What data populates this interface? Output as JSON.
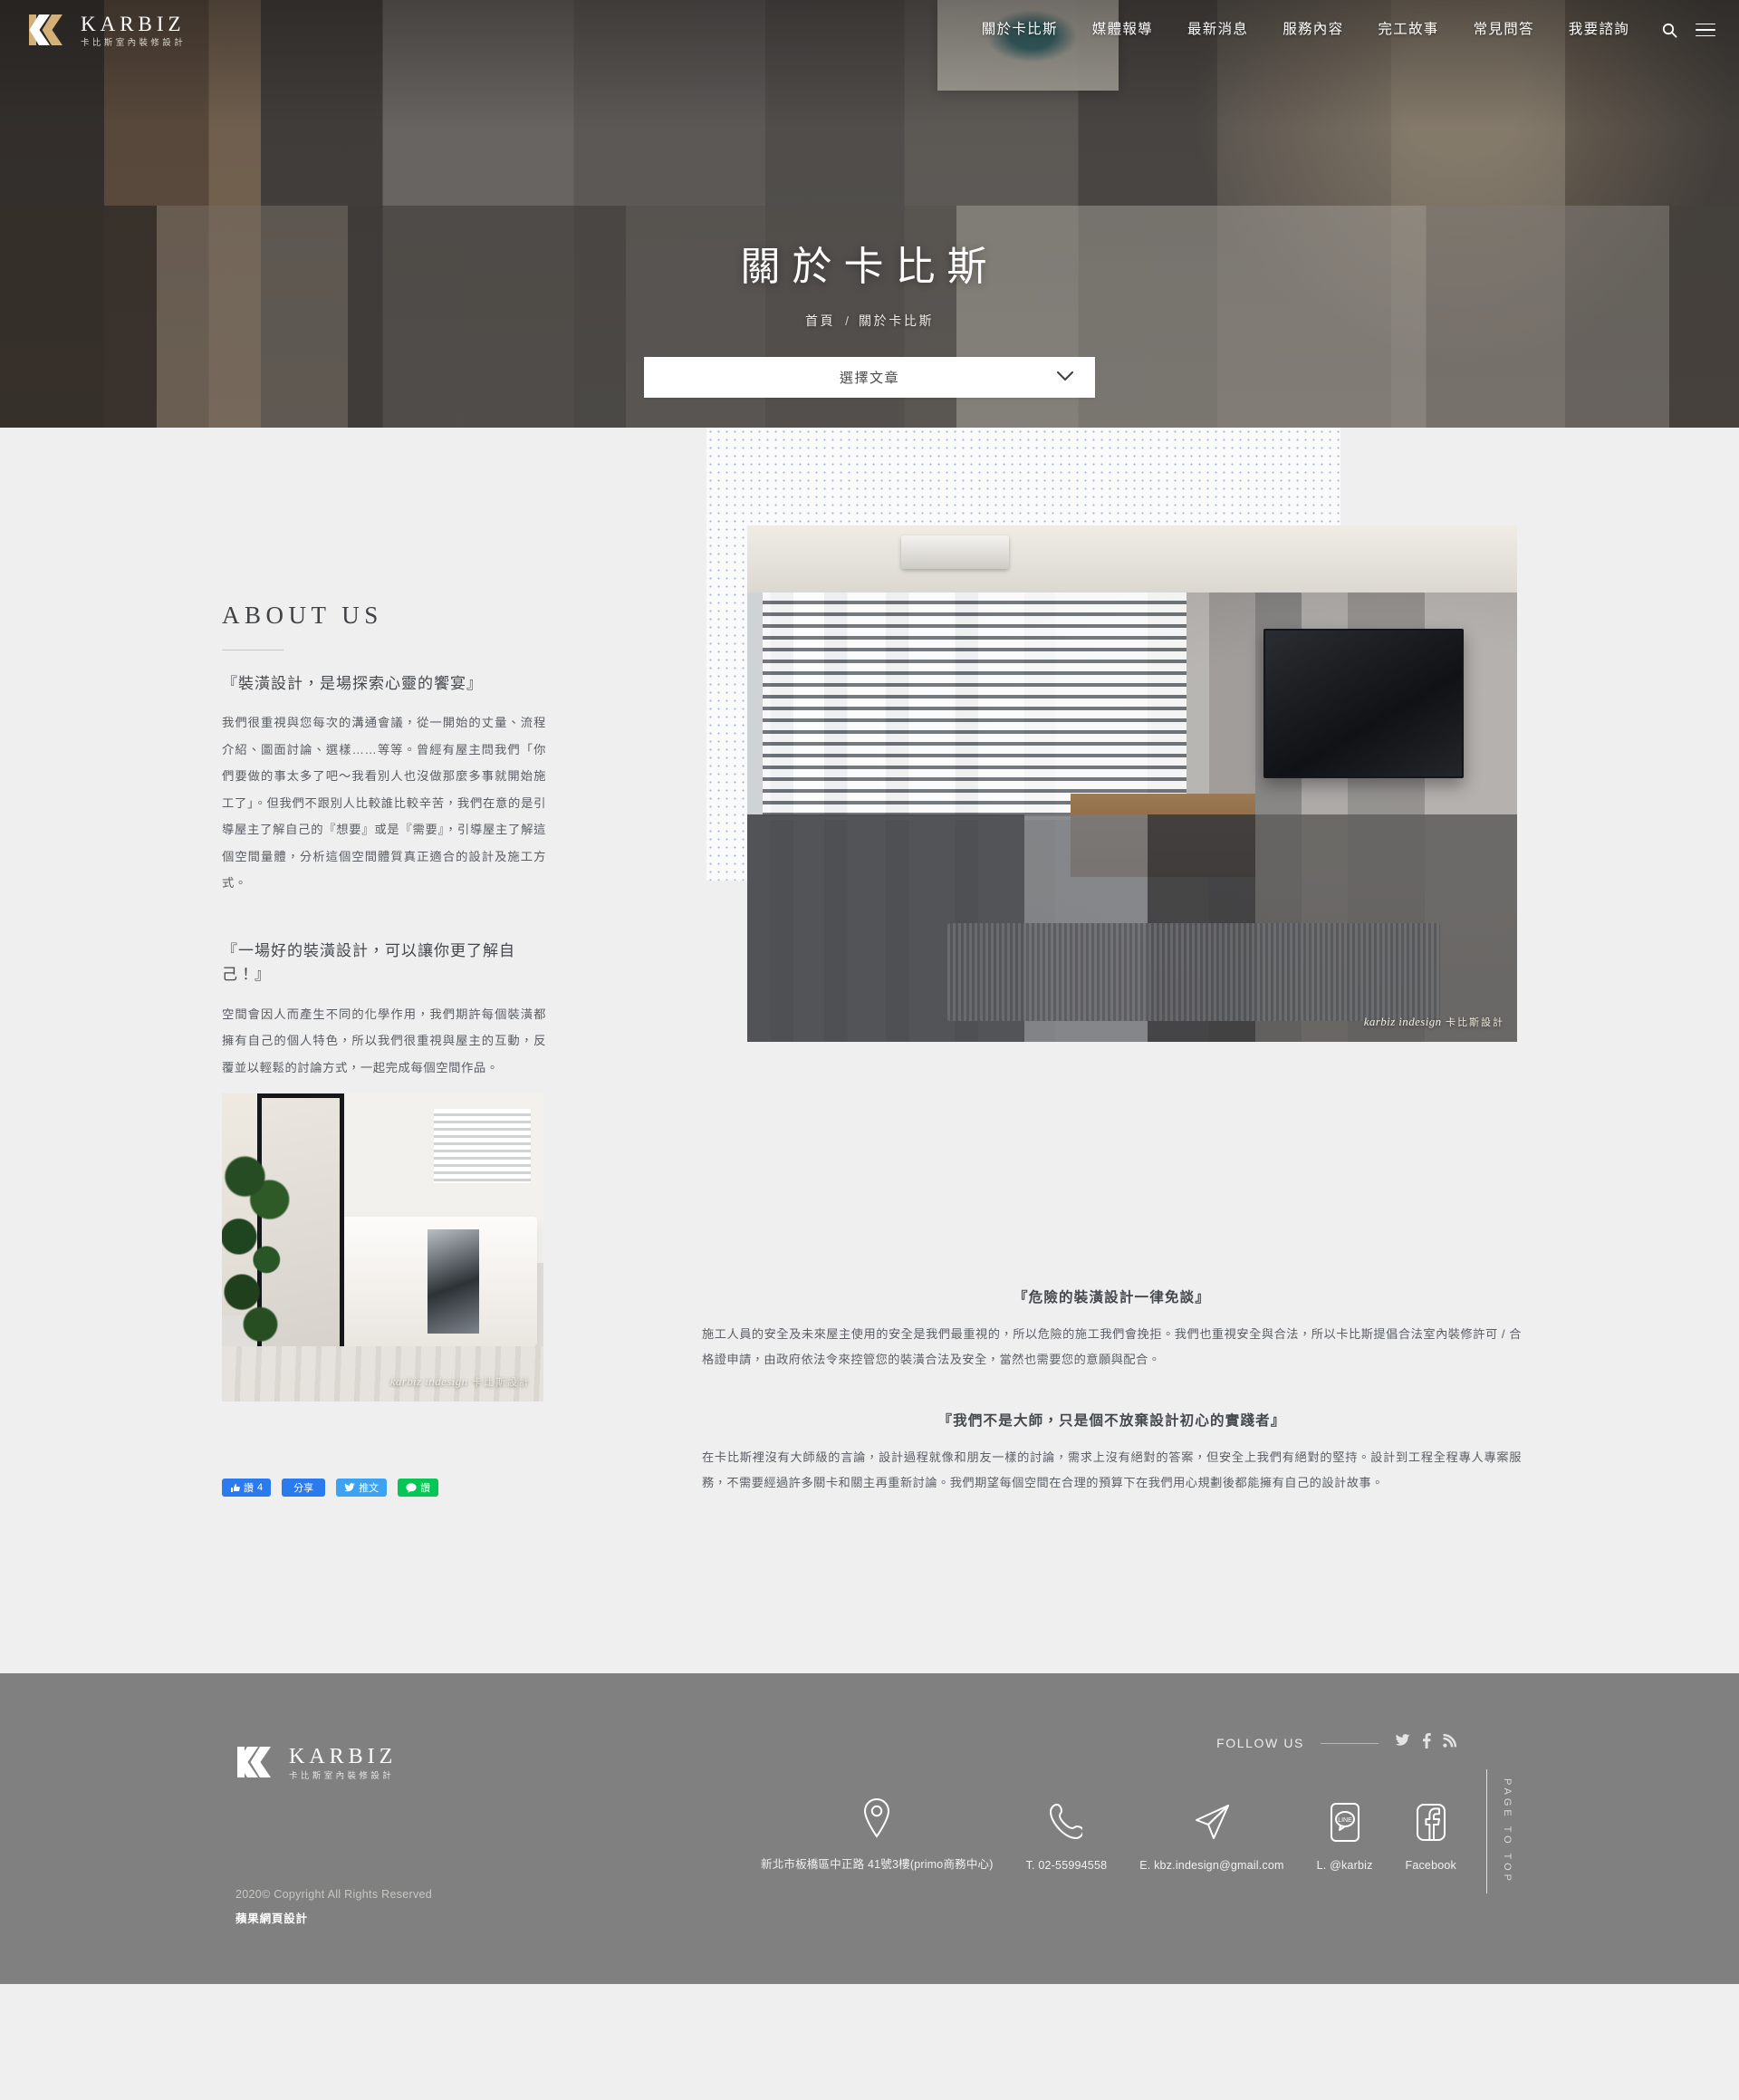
{
  "brand": {
    "name": "KARBIZ",
    "sub": "卡比斯室內裝修設計"
  },
  "nav": {
    "items": [
      {
        "label": "關於卡比斯"
      },
      {
        "label": "媒體報導"
      },
      {
        "label": "最新消息"
      },
      {
        "label": "服務內容"
      },
      {
        "label": "完工故事"
      },
      {
        "label": "常見問答"
      },
      {
        "label": "我要諮詢"
      }
    ],
    "search_icon": "search-icon",
    "menu_icon": "hamburger-menu-icon"
  },
  "hero": {
    "title": "關於卡比斯",
    "breadcrumb": {
      "home": "首頁",
      "separator": "/",
      "current": "關於卡比斯"
    },
    "select": {
      "label": "選擇文章",
      "chevron_icon": "chevron-down-icon"
    }
  },
  "about": {
    "heading": "ABOUT US",
    "lead1": "『裝潢設計，是場探索心靈的饗宴』",
    "para1": "我們很重視與您每次的溝通會議，從一開始的丈量、流程介紹、圖面討論、選樣……等等。曾經有屋主問我們「你們要做的事太多了吧～我看別人也沒做那麼多事就開始施工了」。但我們不跟別人比較誰比較辛苦，我們在意的是引導屋主了解自己的『想要』或是『需要』，引導屋主了解這個空間量體，分析這個空間體質真正適合的設計及施工方式。",
    "lead2": "『一場好的裝潢設計，可以讓你更了解自己！』",
    "para2": "空間會因人而產生不同的化學作用，我們期許每個裝潢都擁有自己的個人特色，所以我們很重視與屋主的互動，反覆並以輕鬆的討論方式，一起完成每個空間作品。"
  },
  "photos": {
    "living": {
      "alt": "現代風客廳實景",
      "watermark_en": "karbiz indesign",
      "watermark_zh": "卡比斯設計"
    },
    "bedroom": {
      "alt": "北歐風臥室實景",
      "watermark_en": "karbiz indesign",
      "watermark_zh": "卡比斯設計"
    }
  },
  "right_copy": {
    "head1": "『危險的裝潢設計一律免談』",
    "para1": "施工人員的安全及未來屋主使用的安全是我們最重視的，所以危險的施工我們會挽拒。我們也重視安全與合法，所以卡比斯提倡合法室內裝修許可 / 合格證申請，由政府依法令來控管您的裝潢合法及安全，當然也需要您的意願與配合。",
    "head2": "『我們不是大師，只是個不放棄設計初心的實踐者』",
    "para2": "在卡比斯裡沒有大師級的言論，設計過程就像和朋友一樣的討論，需求上沒有絕對的答案，但安全上我們有絕對的堅持。設計到工程全程專人專案服務，不需要經過許多關卡和關主再重新討論。我們期望每個空間在合理的預算下在我們用心規劃後都能擁有自己的設計故事。"
  },
  "share": {
    "facebook_like": {
      "label": "讚",
      "count": "4",
      "icon": "thumbs-up-icon"
    },
    "facebook_share": {
      "label": "分享"
    },
    "twitter": {
      "label": "推文",
      "icon": "twitter-bird-icon"
    },
    "line": {
      "label": "讚",
      "icon": "line-chat-icon"
    }
  },
  "footer": {
    "copyright": "2020© Copyright All Rights Reserved",
    "credit": "蘋果網頁設計",
    "follow": {
      "label": "FOLLOW US",
      "socials": [
        {
          "name": "twitter-icon"
        },
        {
          "name": "facebook-icon"
        },
        {
          "name": "rss-icon"
        }
      ]
    },
    "contacts": [
      {
        "icon": "map-pin-icon",
        "text": "新北市板橋區中正路 41號3樓(primo商務中心)"
      },
      {
        "icon": "phone-icon",
        "text": "T. 02-55994558"
      },
      {
        "icon": "paper-plane-icon",
        "text": "E. kbz.indesign@gmail.com"
      },
      {
        "icon": "line-app-icon",
        "text": "L. @karbiz"
      },
      {
        "icon": "facebook-square-icon",
        "text": "Facebook"
      }
    ],
    "page_to_top": "PAGE TO TOP"
  },
  "colors": {
    "page_bg": "#efefef",
    "footer_bg": "#808080",
    "logo_gold": "#d3b077",
    "dot_grid": "#9db3d4",
    "fb_blue": "#2a7bf0",
    "tw_blue": "#3ba3f2",
    "line_green": "#06c755"
  }
}
